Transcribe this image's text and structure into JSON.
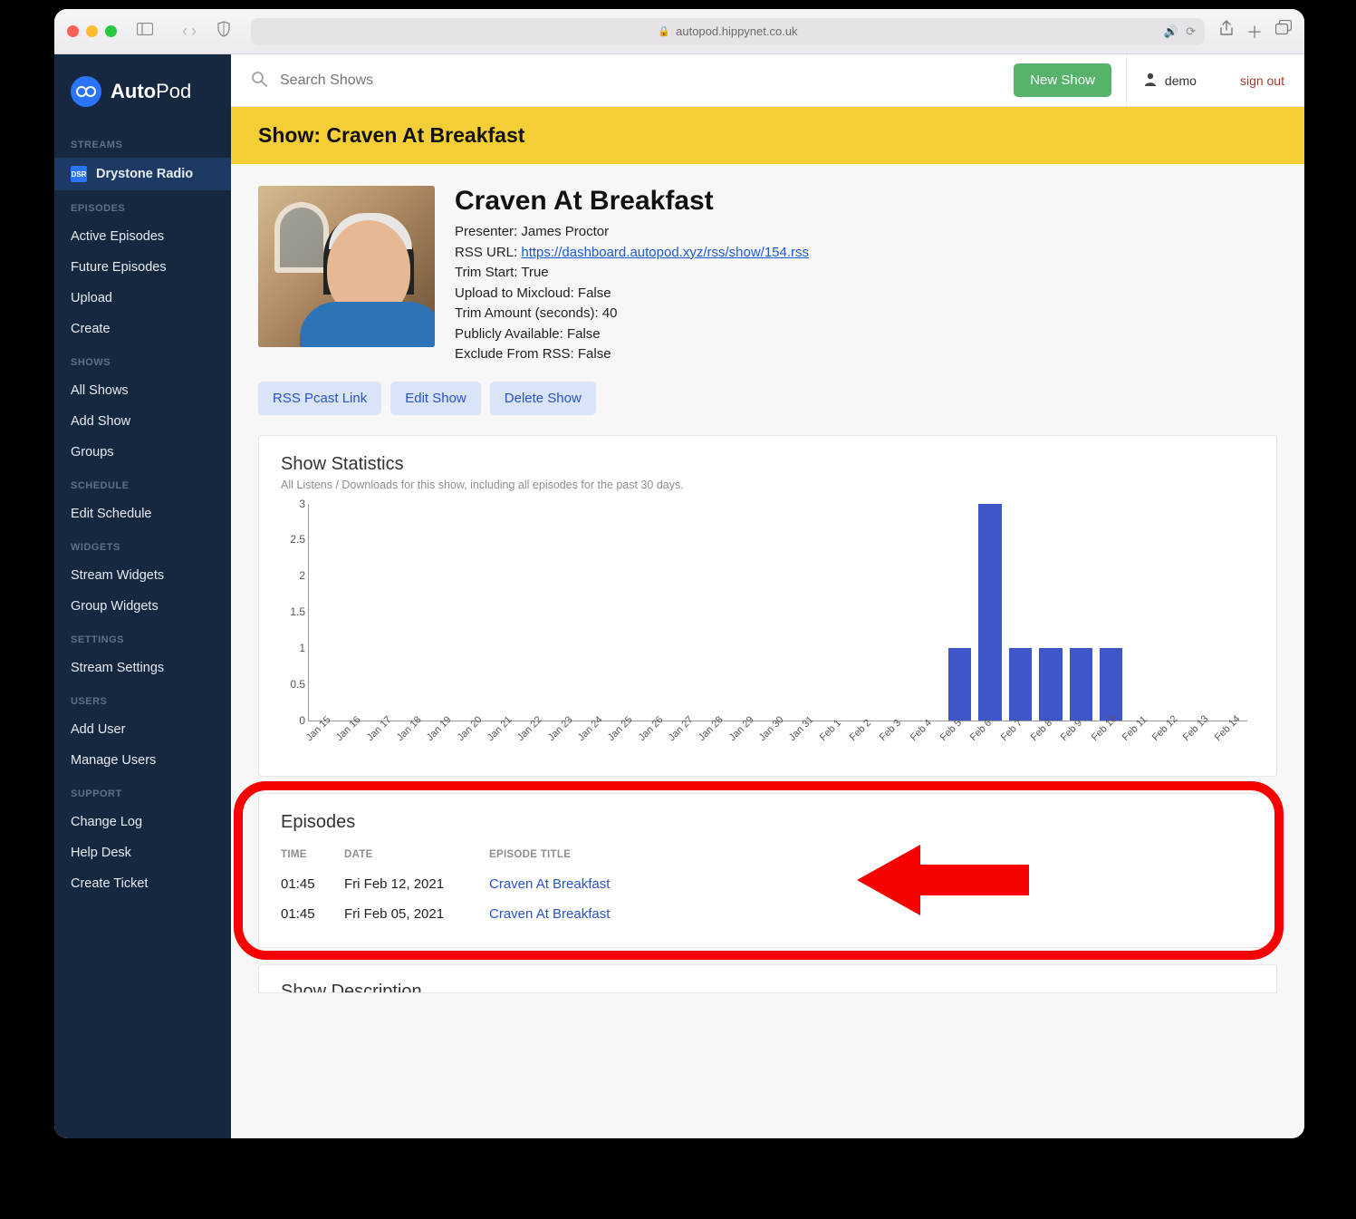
{
  "browser": {
    "url_host": "autopod.hippynet.co.uk"
  },
  "brand": {
    "part1": "Auto",
    "part2": "Pod"
  },
  "topbar": {
    "search_placeholder": "Search Shows",
    "new_show": "New Show",
    "user": "demo",
    "signout": "sign out"
  },
  "sidebar": {
    "streams": {
      "head": "STREAMS",
      "active": "Drystone Radio"
    },
    "episodes": {
      "head": "EPISODES",
      "items": [
        "Active Episodes",
        "Future Episodes",
        "Upload",
        "Create"
      ]
    },
    "shows": {
      "head": "SHOWS",
      "items": [
        "All Shows",
        "Add Show",
        "Groups"
      ]
    },
    "schedule": {
      "head": "SCHEDULE",
      "items": [
        "Edit Schedule"
      ]
    },
    "widgets": {
      "head": "WIDGETS",
      "items": [
        "Stream Widgets",
        "Group Widgets"
      ]
    },
    "settings": {
      "head": "SETTINGS",
      "items": [
        "Stream Settings"
      ]
    },
    "users": {
      "head": "USERS",
      "items": [
        "Add User",
        "Manage Users"
      ]
    },
    "support": {
      "head": "SUPPORT",
      "items": [
        "Change Log",
        "Help Desk",
        "Create Ticket"
      ]
    }
  },
  "page_title": "Show: Craven At Breakfast",
  "show": {
    "name": "Craven At Breakfast",
    "presenter_label": "Presenter: ",
    "presenter": "James Proctor",
    "rss_label": "RSS URL: ",
    "rss_url": "https://dashboard.autopod.xyz/rss/show/154.rss",
    "trim_start": "Trim Start: True",
    "upload_mixcloud": "Upload to Mixcloud: False",
    "trim_amount": "Trim Amount (seconds): 40",
    "public": "Publicly Available: False",
    "exclude_rss": "Exclude From RSS: False",
    "btn_rss": "RSS Pcast Link",
    "btn_edit": "Edit Show",
    "btn_delete": "Delete Show"
  },
  "stats": {
    "title": "Show Statistics",
    "sub": "All Listens / Downloads for this show, including all episodes for the past 30 days."
  },
  "chart_data": {
    "type": "bar",
    "title": "Show Statistics",
    "xlabel": "",
    "ylabel": "",
    "ylim": [
      0,
      3
    ],
    "yticks": [
      0,
      0.5,
      1,
      1.5,
      2,
      2.5,
      3
    ],
    "categories": [
      "Jan 15",
      "Jan 16",
      "Jan 17",
      "Jan 18",
      "Jan 19",
      "Jan 20",
      "Jan 21",
      "Jan 22",
      "Jan 23",
      "Jan 24",
      "Jan 25",
      "Jan 26",
      "Jan 27",
      "Jan 28",
      "Jan 29",
      "Jan 30",
      "Jan 31",
      "Feb 1",
      "Feb 2",
      "Feb 3",
      "Feb 4",
      "Feb 5",
      "Feb 6",
      "Feb 7",
      "Feb 8",
      "Feb 9",
      "Feb 10",
      "Feb 11",
      "Feb 12",
      "Feb 13",
      "Feb 14"
    ],
    "values": [
      0,
      0,
      0,
      0,
      0,
      0,
      0,
      0,
      0,
      0,
      0,
      0,
      0,
      0,
      0,
      0,
      0,
      0,
      0,
      0,
      0,
      1,
      3,
      1,
      1,
      1,
      1,
      0,
      0,
      0,
      0
    ]
  },
  "episodes": {
    "title": "Episodes",
    "headers": {
      "time": "TIME",
      "date": "DATE",
      "title": "EPISODE TITLE"
    },
    "rows": [
      {
        "time": "01:45",
        "date": "Fri Feb 12, 2021",
        "title": "Craven At Breakfast"
      },
      {
        "time": "01:45",
        "date": "Fri Feb 05, 2021",
        "title": "Craven At Breakfast"
      }
    ]
  },
  "cutoff_title": "Show Description"
}
